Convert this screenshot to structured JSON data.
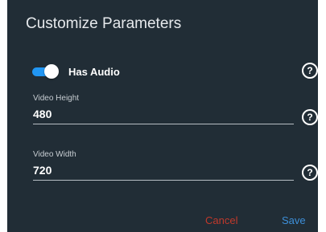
{
  "dialog": {
    "title": "Customize Parameters"
  },
  "has_audio": {
    "label": "Has Audio",
    "enabled": true
  },
  "help_icon": {
    "glyph": "?"
  },
  "video_height": {
    "label": "Video Height",
    "value": "480"
  },
  "video_width": {
    "label": "Video Width",
    "value": "720"
  },
  "actions": {
    "cancel_label": "Cancel",
    "save_label": "Save"
  },
  "colors": {
    "dialog_background": "#212d36",
    "toggle_accent": "#2196f3",
    "cancel": "#c0392b",
    "save": "#3d8fd9"
  },
  "icons": [
    "help-circle-icon"
  ]
}
